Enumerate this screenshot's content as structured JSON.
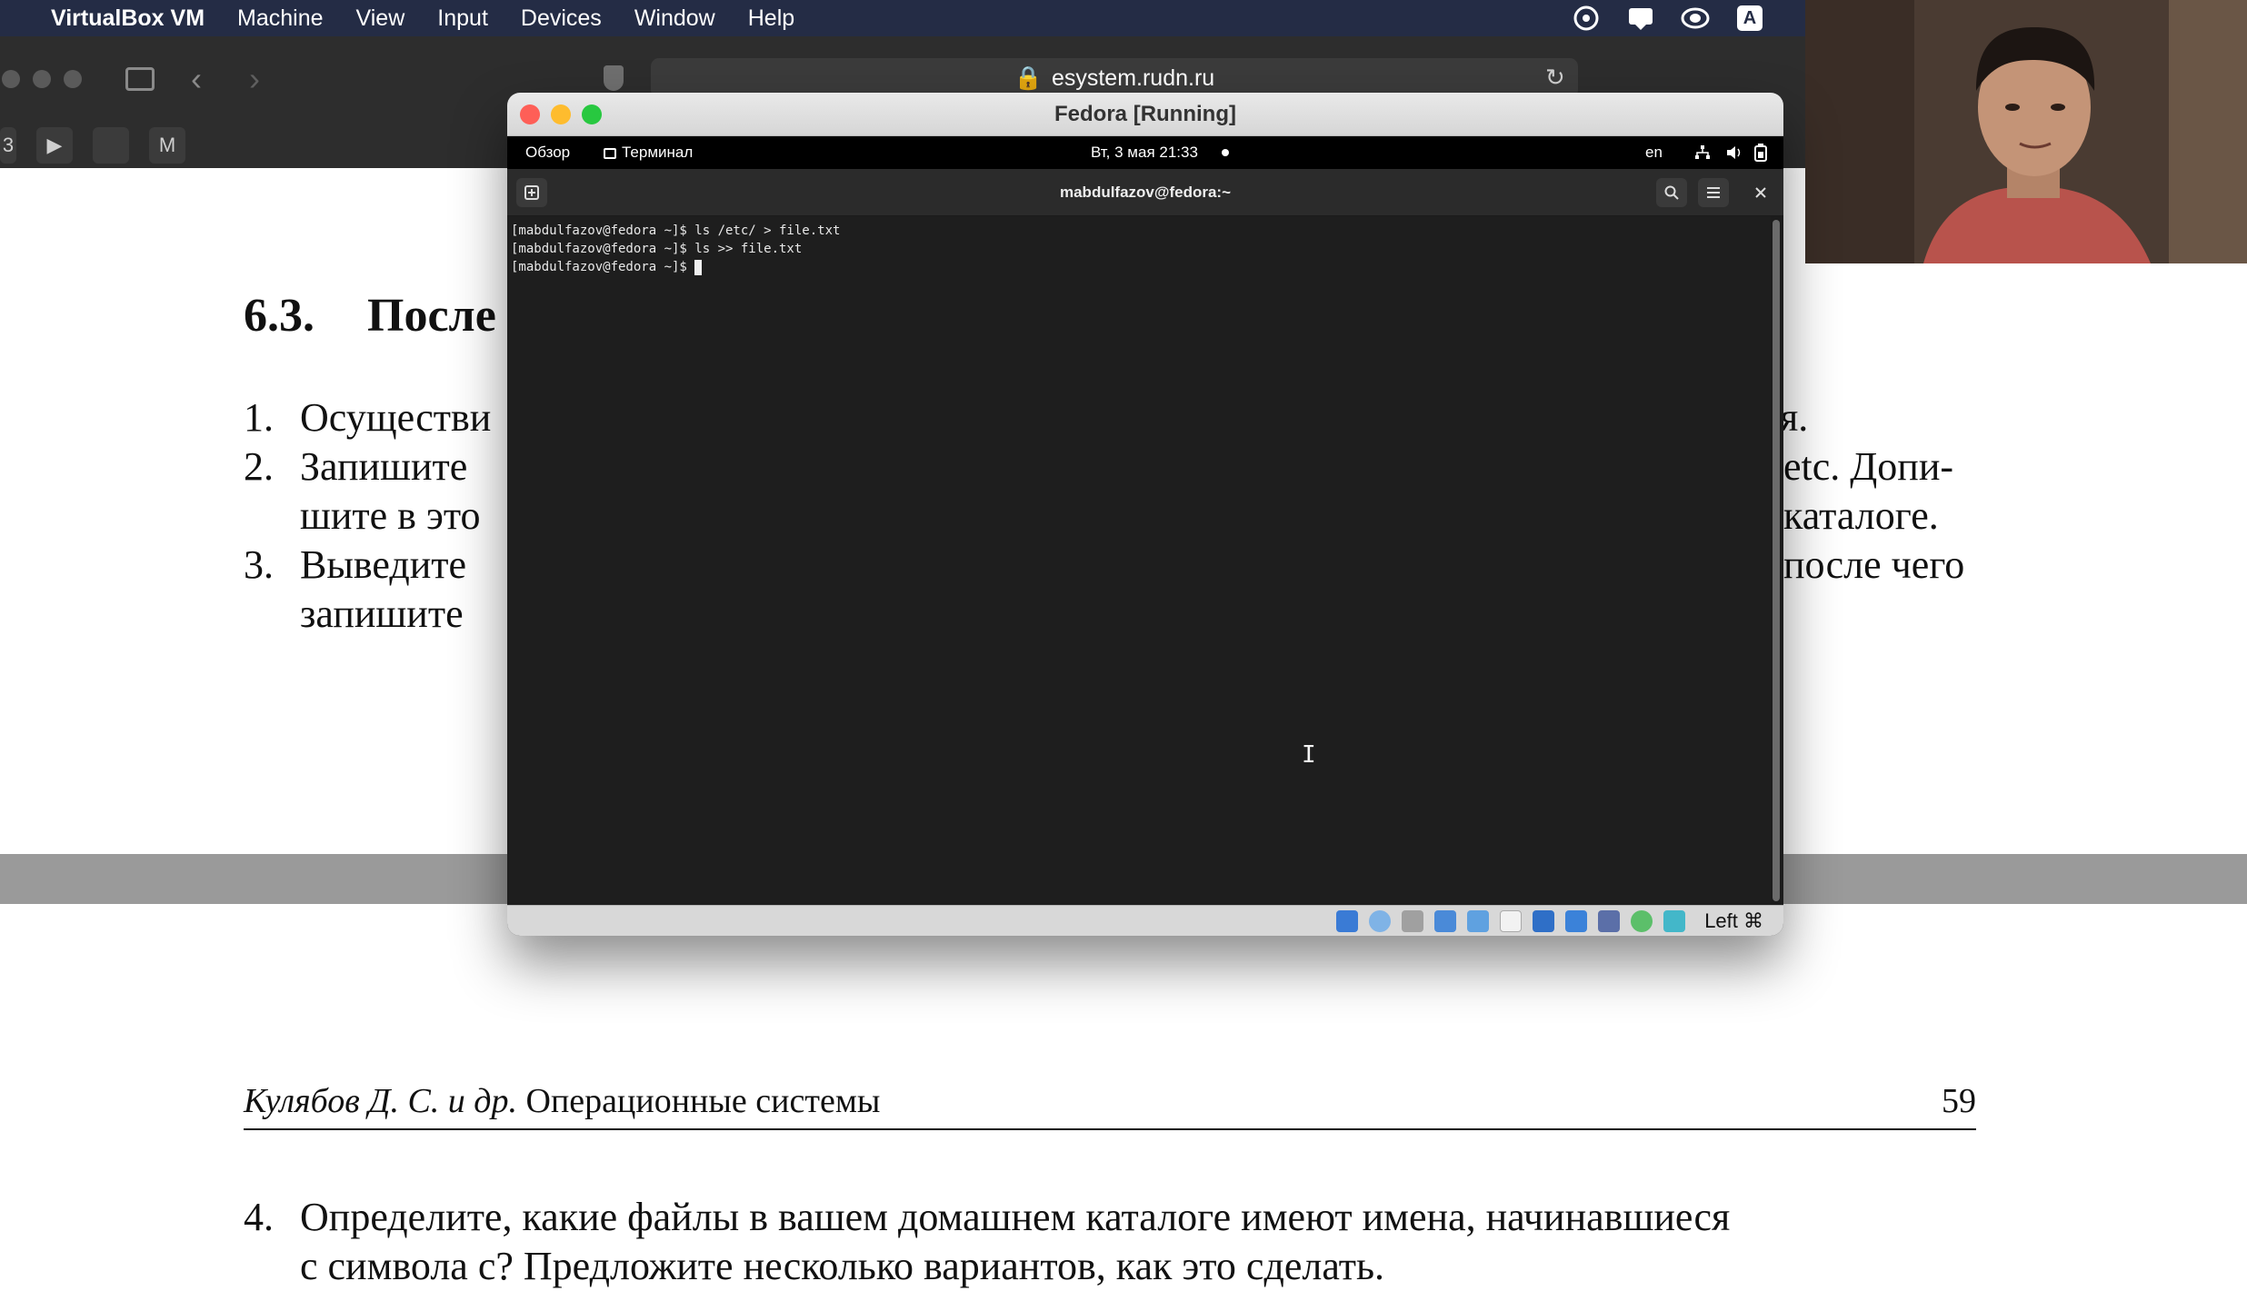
{
  "menubar": {
    "apple": "",
    "app": "VirtualBox VM",
    "items": [
      "Machine",
      "View",
      "Input",
      "Devices",
      "Window",
      "Help"
    ],
    "tray": [
      "creative-cloud-icon",
      "notification-icon",
      "display-icon",
      "A"
    ]
  },
  "safari": {
    "url": "esystem.rudn.ru"
  },
  "document": {
    "section_number": "6.3.",
    "section_title": "После",
    "items": [
      {
        "num": "1.",
        "lines": [
          "Осуществи",
          "я."
        ]
      },
      {
        "num": "2.",
        "lines": [
          "Запишите",
          "etc. Допи-",
          "шите в это",
          "каталоге."
        ]
      },
      {
        "num": "3.",
        "lines": [
          "Выведите",
          "после чего",
          "запишите"
        ]
      }
    ],
    "footer_author": "Кулябов Д. С. и др.",
    "footer_title": "Операционные системы",
    "page_number": "59",
    "item4_num": "4.",
    "item4_line1": "Определите, какие файлы в вашем домашнем каталоге имеют имена, начинавшиеся",
    "item4_line2": "с символа c? Предложите несколько вариантов, как это сделать."
  },
  "vbox": {
    "title": "Fedora [Running]",
    "gnome": {
      "overview": "Обзор",
      "terminal_app": "Терминал",
      "datetime": "Вт, 3 мая  21:33",
      "lang": "en"
    },
    "terminal": {
      "title": "mabdulfazov@fedora:~",
      "lines": [
        "[mabdulfazov@fedora ~]$ ls /etc/ > file.txt",
        "[mabdulfazov@fedora ~]$ ls >> file.txt",
        "[mabdulfazov@fedora ~]$ "
      ]
    },
    "hostkey": "Left ⌘"
  }
}
